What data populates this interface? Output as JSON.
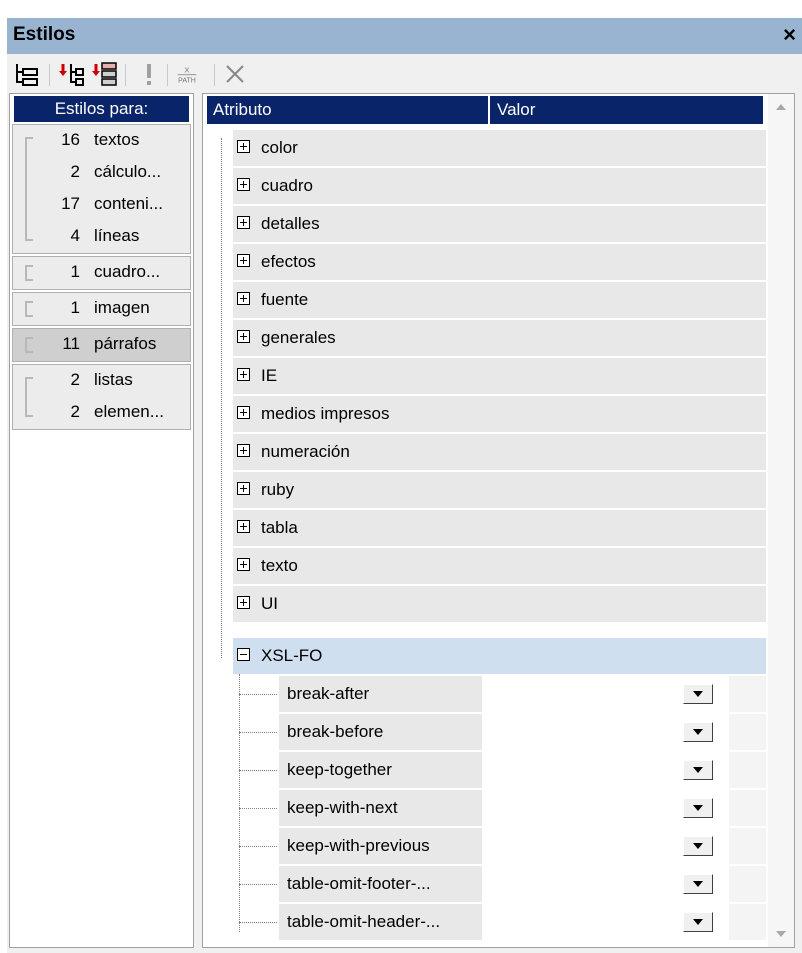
{
  "window": {
    "title": "Estilos",
    "close_label": "×"
  },
  "toolbar": {
    "icons": [
      "tree-view-icon",
      "add-style-icon",
      "add-style-alt-icon",
      "important-icon",
      "xpath-icon",
      "delete-icon"
    ],
    "xpath_label": "X PATH"
  },
  "left_panel": {
    "header": "Estilos para:",
    "groups": [
      {
        "items": [
          {
            "count": "16",
            "name": "textos"
          },
          {
            "count": "2",
            "name": "cálculo..."
          },
          {
            "count": "17",
            "name": "conteni..."
          },
          {
            "count": "4",
            "name": "líneas"
          }
        ]
      },
      {
        "items": [
          {
            "count": "1",
            "name": "cuadro..."
          }
        ]
      },
      {
        "items": [
          {
            "count": "1",
            "name": "imagen"
          }
        ]
      },
      {
        "items": [
          {
            "count": "11",
            "name": "párrafos",
            "selected": true
          }
        ]
      },
      {
        "items": [
          {
            "count": "2",
            "name": "listas"
          },
          {
            "count": "2",
            "name": "elemen..."
          }
        ]
      }
    ]
  },
  "right_panel": {
    "col_attr": "Atributo",
    "col_value": "Valor",
    "groups": [
      "color",
      "cuadro",
      "detalles",
      "efectos",
      "fuente",
      "generales",
      "IE",
      "medios impresos",
      "numeración",
      "ruby",
      "tabla",
      "texto",
      "UI"
    ],
    "expanded": {
      "label": "XSL-FO",
      "children": [
        "break-after",
        "break-before",
        "keep-together",
        "keep-with-next",
        "keep-with-previous",
        "table-omit-footer-...",
        "table-omit-header-..."
      ]
    }
  },
  "colors": {
    "titlebar": "#99b4d1",
    "header": "#0a246a",
    "expanded_row": "#cfdff0"
  }
}
